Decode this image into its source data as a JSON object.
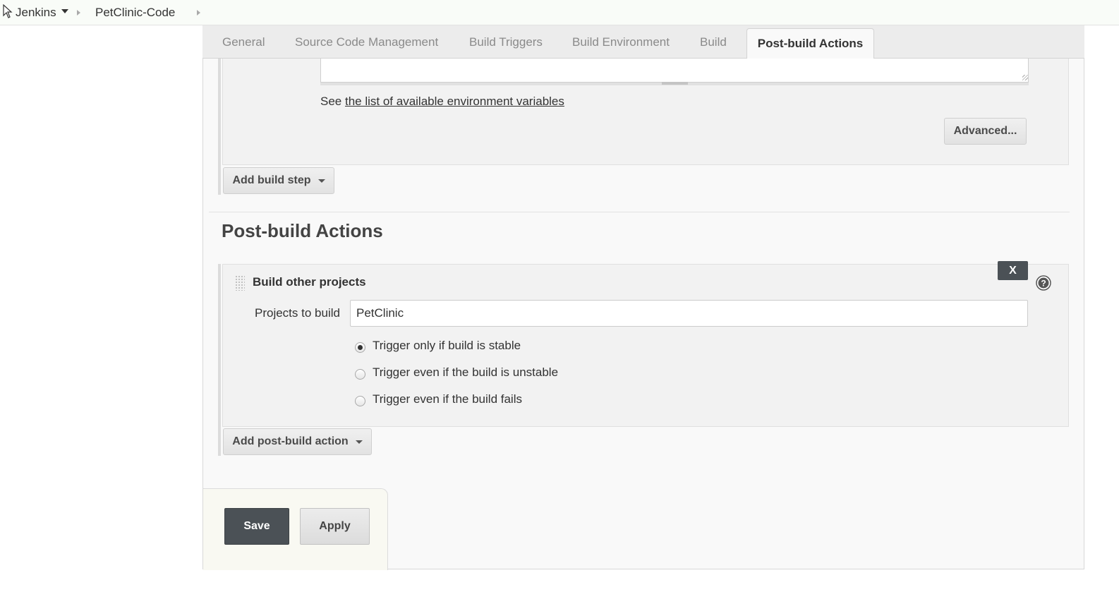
{
  "breadcrumb": {
    "items": [
      "Jenkins",
      "PetClinic-Code"
    ]
  },
  "tabs": {
    "items": [
      "General",
      "Source Code Management",
      "Build Triggers",
      "Build Environment",
      "Build"
    ],
    "active": "Post-build Actions"
  },
  "build_section": {
    "env_prefix": "See",
    "env_link": "the list of available environment variables",
    "advanced_label": "Advanced...",
    "add_step_label": "Add build step"
  },
  "post_build": {
    "section_title": "Post-build Actions",
    "action_title": "Build other projects",
    "close_label": "X",
    "projects_label": "Projects to build",
    "projects_value": "PetClinic",
    "radio_options": [
      {
        "label": "Trigger only if build is stable",
        "checked": true
      },
      {
        "label": "Trigger even if the build is unstable",
        "checked": false
      },
      {
        "label": "Trigger even if the build fails",
        "checked": false
      }
    ],
    "add_action_label": "Add post-build action"
  },
  "footer": {
    "save_label": "Save",
    "apply_label": "Apply"
  },
  "colors": {
    "dark_button": "#4b5156",
    "panel_bg": "#f2f2f2",
    "tabbar_bg": "#ececec"
  },
  "icons": {
    "cursor": "cursor-icon",
    "help": "help-icon",
    "drag": "drag-handle-icon"
  }
}
